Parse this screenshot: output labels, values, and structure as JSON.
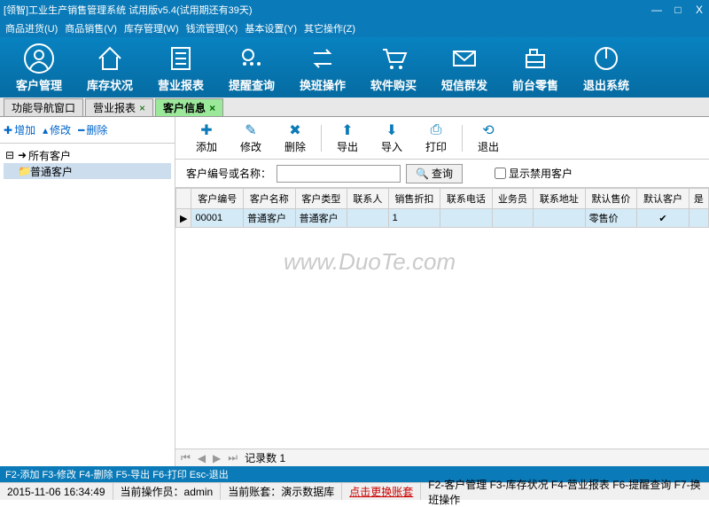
{
  "window": {
    "title": "[领智]工业生产销售管理系统 试用版v5.4(试用期还有39天)"
  },
  "menus": [
    "商品进货(U)",
    "商品销售(V)",
    "库存管理(W)",
    "钱流管理(X)",
    "基本设置(Y)",
    "其它操作(Z)"
  ],
  "mainToolbar": [
    {
      "id": "cust-mgmt",
      "label": "客户管理",
      "icon": "person"
    },
    {
      "id": "stock",
      "label": "库存状况",
      "icon": "house"
    },
    {
      "id": "biz-report",
      "label": "营业报表",
      "icon": "report"
    },
    {
      "id": "remind",
      "label": "提醒查询",
      "icon": "remind"
    },
    {
      "id": "shift",
      "label": "换班操作",
      "icon": "swap"
    },
    {
      "id": "buy",
      "label": "软件购买",
      "icon": "cart"
    },
    {
      "id": "sms",
      "label": "短信群发",
      "icon": "mail"
    },
    {
      "id": "pos",
      "label": "前台零售",
      "icon": "register"
    },
    {
      "id": "exit",
      "label": "退出系统",
      "icon": "power"
    }
  ],
  "tabs": [
    {
      "label": "功能导航窗口",
      "close": false,
      "active": false
    },
    {
      "label": "营业报表",
      "close": true,
      "active": false
    },
    {
      "label": "客户信息",
      "close": true,
      "active": true
    }
  ],
  "leftToolbar": {
    "add": "增加",
    "edit": "修改",
    "del": "删除"
  },
  "tree": [
    {
      "label": "所有客户",
      "level": 0,
      "sel": false,
      "icon": "➜"
    },
    {
      "label": "普通客户",
      "level": 1,
      "sel": true,
      "icon": "📁"
    }
  ],
  "actions": [
    {
      "id": "add",
      "label": "添加",
      "icon": "✚"
    },
    {
      "id": "edit",
      "label": "修改",
      "icon": "✎"
    },
    {
      "id": "del",
      "label": "删除",
      "icon": "✖"
    },
    {
      "sep": true
    },
    {
      "id": "export",
      "label": "导出",
      "icon": "⬆"
    },
    {
      "id": "import",
      "label": "导入",
      "icon": "⬇"
    },
    {
      "id": "print",
      "label": "打印",
      "icon": "⎙"
    },
    {
      "sep": true
    },
    {
      "id": "exit2",
      "label": "退出",
      "icon": "⟲"
    }
  ],
  "search": {
    "label": "客户编号或名称：",
    "placeholder": "",
    "btn": "查询",
    "cb": "显示禁用客户"
  },
  "gridCols": [
    "客户编号",
    "客户名称",
    "客户类型",
    "联系人",
    "销售折扣",
    "联系电话",
    "业务员",
    "联系地址",
    "默认售价",
    "默认客户",
    "是"
  ],
  "gridRows": [
    {
      "cells": [
        "00001",
        "普通客户",
        "普通客户",
        "",
        "1",
        "",
        "",
        "",
        "零售价",
        "✔",
        ""
      ]
    }
  ],
  "recordBar": {
    "label": "记录数",
    "count": "1"
  },
  "hintBar": "F2-添加 F3-修改 F4-删除 F5-导出 F6-打印 Esc-退出",
  "statusBar": {
    "datetime": "2015-11-06 16:34:49",
    "operator": "当前操作员：admin",
    "account": "当前账套：演示数据库",
    "switch": "点击更换账套",
    "fkeys": "F2-客户管理 F3-库存状况 F4-营业报表 F6-提醒查询 F7-换班操作"
  },
  "watermark": "www.DuoTe.com"
}
